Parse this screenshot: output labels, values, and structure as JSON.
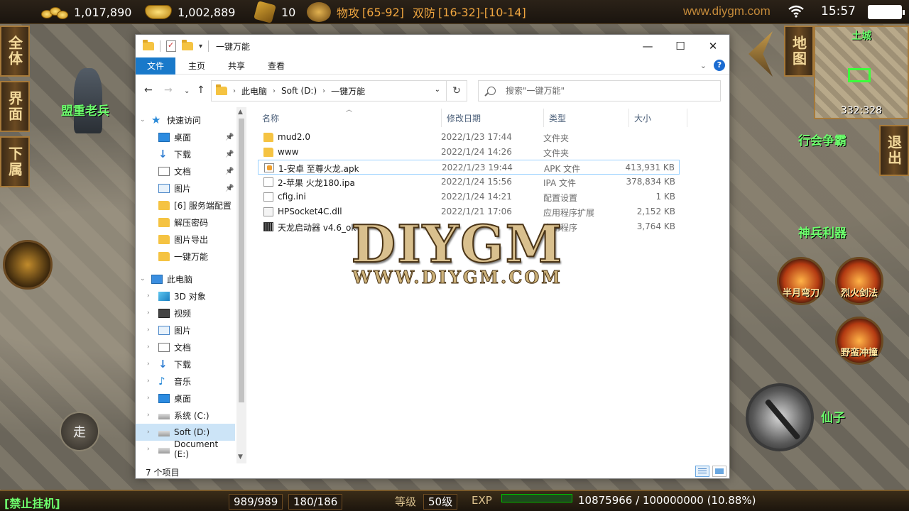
{
  "hud": {
    "gold": "1,017,890",
    "ingots": "1,002,889",
    "badges": "10",
    "attack_label": "物攻",
    "attack_value": "[65-92]",
    "defense_label": "双防",
    "defense_value": "[16-32]-[10-14]",
    "site": "www.diygm.com",
    "time": "15:57",
    "side_left": [
      "全体",
      "界面",
      "下属"
    ],
    "side_right_map": "地图",
    "side_right_exit": "退出",
    "npc": "盟重老兵",
    "guild_label": "行会争霸",
    "weapon_label": "神兵利器",
    "minimap_city": "土城",
    "minimap_coord": "332:328",
    "walk": "走",
    "skills": [
      "半月弯刀",
      "烈火剑法",
      "野蛮冲撞"
    ],
    "player_name": "仙子",
    "ban_hang": "[禁止挂机]",
    "hp": "989/989",
    "mp": "180/186",
    "level_label": "等级",
    "level_value": "50级",
    "exp_label": "EXP",
    "exp_value": "10875966 / 100000000 (10.88%)"
  },
  "watermark": {
    "big": "DIYGM",
    "small": "WWW.DIYGM.COM"
  },
  "explorer": {
    "title": "一键万能",
    "ribbon_tabs": [
      "文件",
      "主页",
      "共享",
      "查看"
    ],
    "help": "?",
    "address": [
      "此电脑",
      "Soft (D:)",
      "一键万能"
    ],
    "search_placeholder": "搜索\"一键万能\"",
    "nav": [
      {
        "label": "快速访问",
        "icon": "star-icon",
        "level": 0,
        "expander": "⌄"
      },
      {
        "label": "桌面",
        "icon": "desktop-icon",
        "level": 1,
        "pinned": true
      },
      {
        "label": "下载",
        "icon": "download-icon",
        "level": 1,
        "pinned": true
      },
      {
        "label": "文档",
        "icon": "document-icon",
        "level": 1,
        "pinned": true
      },
      {
        "label": "图片",
        "icon": "picture-icon",
        "level": 1,
        "pinned": true
      },
      {
        "label": "[6] 服务端配置",
        "icon": "folder-icon",
        "level": 1
      },
      {
        "label": "解压密码",
        "icon": "folder-icon",
        "level": 1
      },
      {
        "label": "图片导出",
        "icon": "folder-icon",
        "level": 1
      },
      {
        "label": "一键万能",
        "icon": "folder-icon",
        "level": 1
      },
      {
        "label": "此电脑",
        "icon": "computer-icon",
        "level": 0,
        "expander": "⌄"
      },
      {
        "label": "3D 对象",
        "icon": "cube-icon",
        "level": 1,
        "expander": "›"
      },
      {
        "label": "视频",
        "icon": "video-icon",
        "level": 1,
        "expander": "›"
      },
      {
        "label": "图片",
        "icon": "picture-icon",
        "level": 1,
        "expander": "›"
      },
      {
        "label": "文档",
        "icon": "document-icon",
        "level": 1,
        "expander": "›"
      },
      {
        "label": "下载",
        "icon": "download-icon",
        "level": 1,
        "expander": "›"
      },
      {
        "label": "音乐",
        "icon": "music-icon",
        "level": 1,
        "expander": "›"
      },
      {
        "label": "桌面",
        "icon": "desktop-icon",
        "level": 1,
        "expander": "›"
      },
      {
        "label": "系统 (C:)",
        "icon": "drive-icon",
        "level": 1,
        "expander": "›"
      },
      {
        "label": "Soft (D:)",
        "icon": "drive-icon",
        "level": 1,
        "expander": "›",
        "selected": true
      },
      {
        "label": "Document (E:)",
        "icon": "drive-icon",
        "level": 1,
        "expander": "›"
      }
    ],
    "columns": {
      "name": "名称",
      "date": "修改日期",
      "type": "类型",
      "size": "大小"
    },
    "files": [
      {
        "name": "mud2.0",
        "date": "2022/1/23 17:44",
        "type": "文件夹",
        "size": "",
        "icon": "folder-icon"
      },
      {
        "name": "www",
        "date": "2022/1/24 14:26",
        "type": "文件夹",
        "size": "",
        "icon": "folder-icon"
      },
      {
        "name": "1-安卓 至尊火龙.apk",
        "date": "2022/1/23 19:44",
        "type": "APK 文件",
        "size": "413,931 KB",
        "icon": "apk-icon",
        "selected": true
      },
      {
        "name": "2-苹果 火龙180.ipa",
        "date": "2022/1/24 15:56",
        "type": "IPA 文件",
        "size": "378,834 KB",
        "icon": "file-icon"
      },
      {
        "name": "cfig.ini",
        "date": "2022/1/24 14:21",
        "type": "配置设置",
        "size": "1 KB",
        "icon": "ini-icon"
      },
      {
        "name": "HPSocket4C.dll",
        "date": "2022/1/21 17:06",
        "type": "应用程序扩展",
        "size": "2,152 KB",
        "icon": "dll-icon"
      },
      {
        "name": "天龙启动器 v4.6_ok",
        "date": "",
        "type": "应用程序",
        "size": "3,764 KB",
        "icon": "exe-icon"
      }
    ],
    "status_count": "7 个项目"
  }
}
